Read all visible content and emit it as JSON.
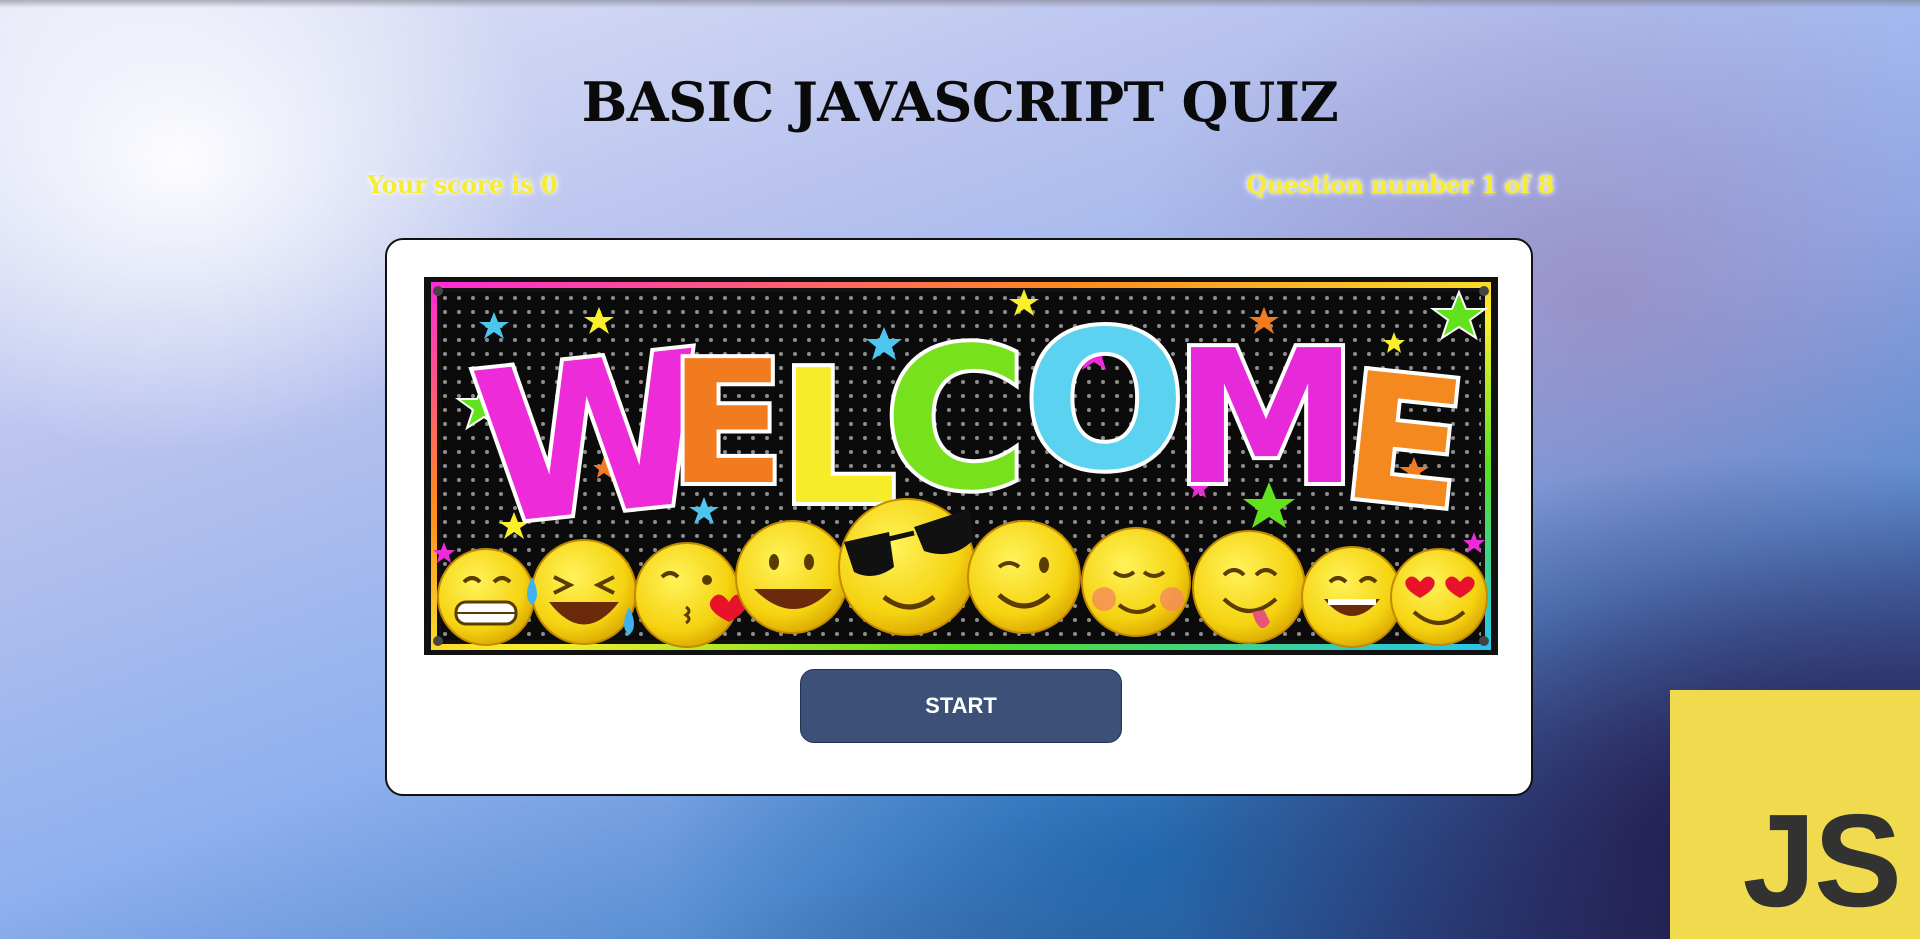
{
  "header": {
    "title": "BASIC JAVASCRIPT QUIZ"
  },
  "status": {
    "score_text": "Your score is 0",
    "question_text": "Question number 1 of 8"
  },
  "card": {
    "banner": {
      "heading": "WELCOME",
      "letter_colors": [
        "#ee2bd8",
        "#f27b1f",
        "#f6ec2a",
        "#77e11e",
        "#5bd2f0",
        "#e62ad9",
        "#f4891f"
      ],
      "emoji_count": 10
    },
    "start_button_label": "START"
  },
  "logo": {
    "text": "JS",
    "background": "#f0db4f",
    "text_color": "#323330"
  },
  "colors": {
    "status_text": "#f7ec34",
    "button": "#3d5078"
  }
}
